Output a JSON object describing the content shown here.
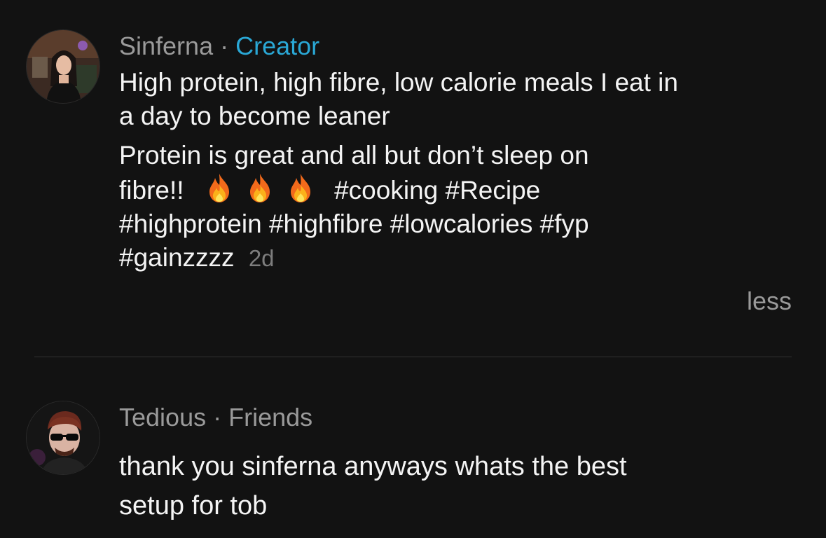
{
  "comments": [
    {
      "author": "Sinferna",
      "separator": "·",
      "role": "Creator",
      "avatar_icon": "profile-photo-woman",
      "title_lines": [
        "High protein, high fibre, low calorie meals I eat in",
        "a day to become leaner"
      ],
      "body_line1": "Protein is great and all but don’t sleep on",
      "body_line2_prefix": "fibre!!",
      "emoji_icon": "fire-emoji",
      "body_line2_suffix": "#cooking #Recipe",
      "body_line3": "#highprotein #highfibre #lowcalories #fyp",
      "body_line4": "#gainzzzz",
      "time": "2d",
      "toggle_label": "less"
    },
    {
      "author": "Tedious",
      "separator": "·",
      "role": "Friends",
      "avatar_icon": "profile-photo-man-sunglasses",
      "text_lines": [
        "thank you sinferna anyways whats the best",
        "setup for tob"
      ]
    }
  ],
  "colors": {
    "background": "#121212",
    "creator_badge": "#2aa8d6",
    "meta_text": "#9a9a9a",
    "body_text": "#f4f4f4"
  }
}
